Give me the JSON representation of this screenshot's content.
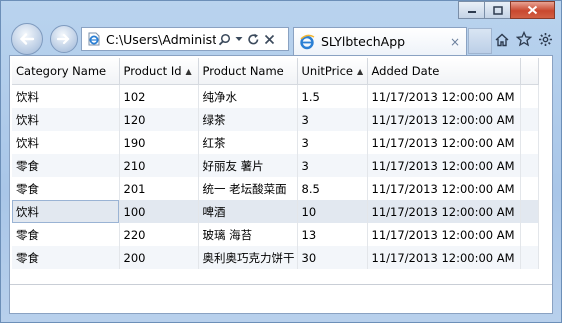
{
  "browser": {
    "address": {
      "url": "C:\\Users\\Administ"
    },
    "tab": {
      "title": "SLYlbtechApp",
      "close": "×"
    }
  },
  "grid": {
    "columns": [
      {
        "label": "Category Name",
        "sorted": false
      },
      {
        "label": "Product Id",
        "sorted": true
      },
      {
        "label": "Product Name",
        "sorted": false
      },
      {
        "label": "UnitPrice",
        "sorted": true
      },
      {
        "label": "Added Date",
        "sorted": false
      }
    ],
    "sort_glyph": "▲",
    "rows": [
      {
        "category": "饮料",
        "id": "102",
        "name": "纯净水",
        "price": "1.5",
        "date": "11/17/2013 12:00:00 AM"
      },
      {
        "category": "饮料",
        "id": "120",
        "name": "绿茶",
        "price": "3",
        "date": "11/17/2013 12:00:00 AM"
      },
      {
        "category": "饮料",
        "id": "190",
        "name": "红茶",
        "price": "3",
        "date": "11/17/2013 12:00:00 AM"
      },
      {
        "category": "零食",
        "id": "210",
        "name": "好丽友 薯片",
        "price": "3",
        "date": "11/17/2013 12:00:00 AM"
      },
      {
        "category": "零食",
        "id": "201",
        "name": "统一 老坛酸菜面",
        "price": "8.5",
        "date": "11/17/2013 12:00:00 AM"
      },
      {
        "category": "饮料",
        "id": "100",
        "name": "啤酒",
        "price": "10",
        "date": "11/17/2013 12:00:00 AM"
      },
      {
        "category": "零食",
        "id": "220",
        "name": "玻璃 海苔",
        "price": "13",
        "date": "11/17/2013 12:00:00 AM"
      },
      {
        "category": "零食",
        "id": "200",
        "name": "奥利奥巧克力饼干",
        "price": "30",
        "date": "11/17/2013 12:00:00 AM"
      }
    ],
    "selected_row": 5
  },
  "colors": {
    "title_bar": "#b9d3ee",
    "close_button": "#c9482f",
    "selected_row": "#e2e8f0"
  }
}
